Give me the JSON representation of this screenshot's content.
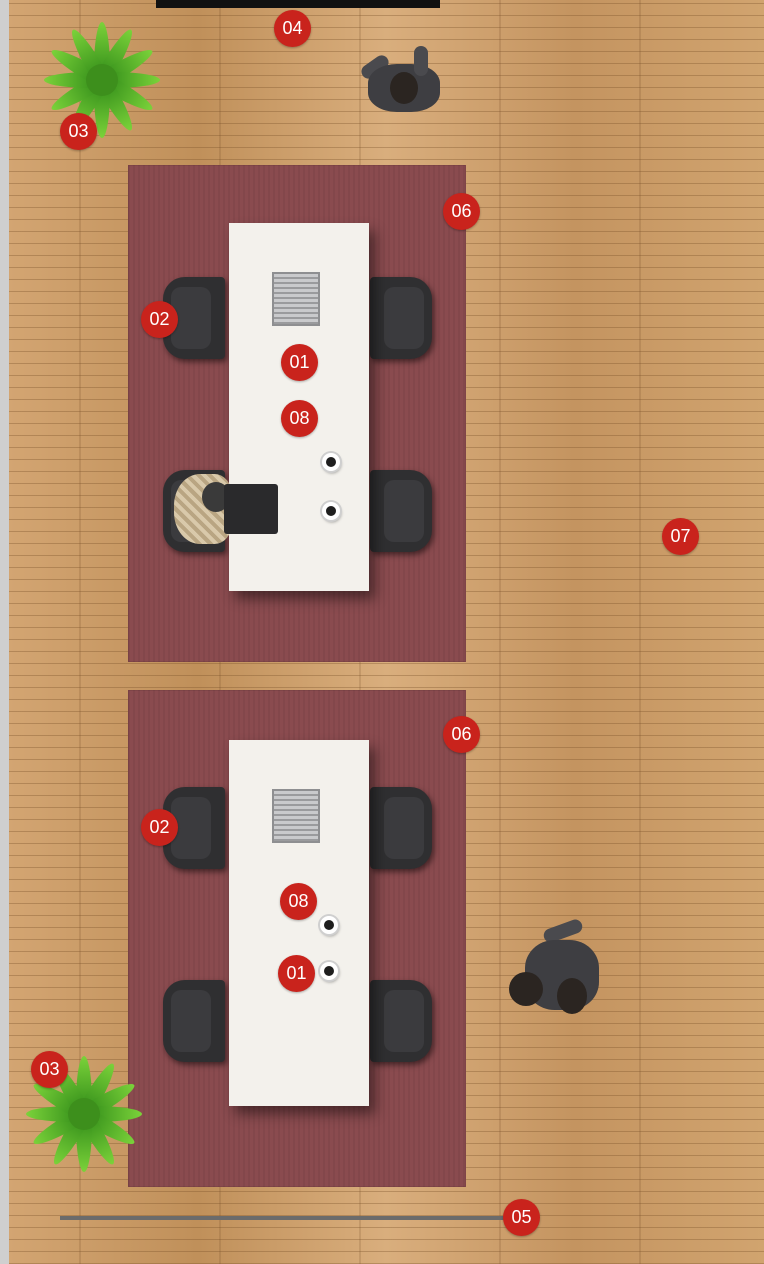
{
  "plan": {
    "markers": {
      "table": "01",
      "chair": "02",
      "plant": "03",
      "door": "04",
      "wall_line": "05",
      "rug": "06",
      "floor": "07",
      "cups": "08"
    }
  },
  "icons": [
    "laptop-icon",
    "coffee-cup-icon",
    "plant-icon",
    "person-icon",
    "chair-icon"
  ],
  "colors": {
    "badge": "#c9231c",
    "rug": "#8a4b4f",
    "table": "#f3f1ec",
    "chair": "#2f2f31",
    "floor": "#c99b66"
  }
}
